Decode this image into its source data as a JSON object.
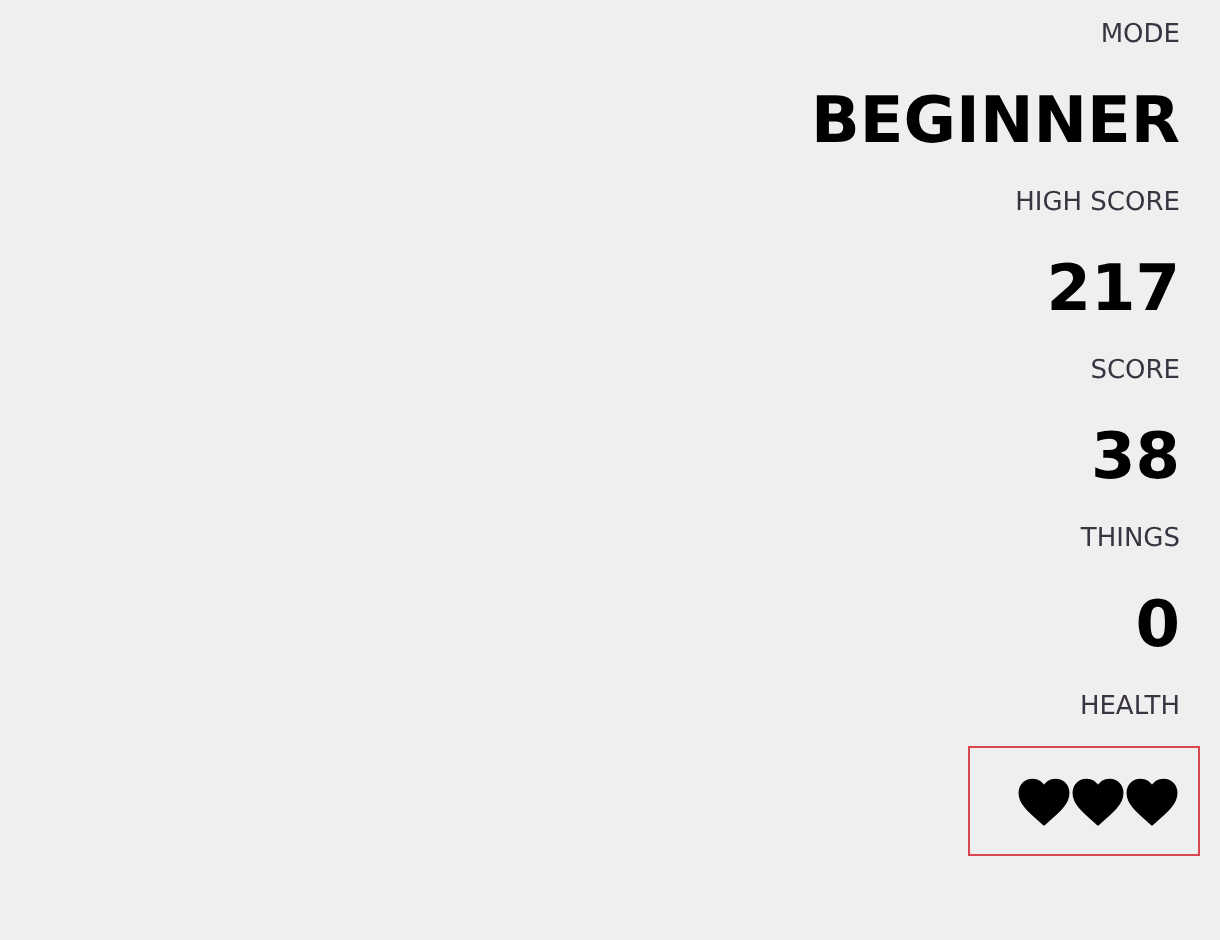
{
  "stats": [
    {
      "label": "MODE",
      "value": "BEGINNER"
    },
    {
      "label": "HIGH SCORE",
      "value": "217"
    },
    {
      "label": "SCORE",
      "value": "38"
    },
    {
      "label": "THINGS",
      "value": "0"
    }
  ],
  "health": {
    "label": "HEALTH",
    "highlighted": true,
    "hearts": [
      {
        "filled": true
      },
      {
        "filled": true
      },
      {
        "filled": true
      }
    ]
  }
}
